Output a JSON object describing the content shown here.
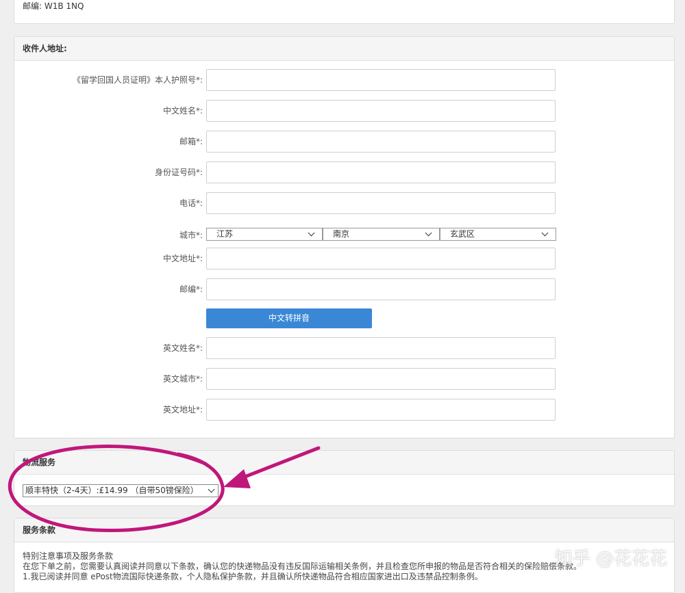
{
  "top_panel": {
    "postcode_line": "邮编:  W1B 1NQ"
  },
  "recipient": {
    "title": "收件人地址:",
    "fields": {
      "passport": "《留学回国人员证明》本人护照号*:",
      "cn_name": "中文姓名*:",
      "email": "邮箱*:",
      "id_number": "身份证号码*:",
      "phone": "电话*:",
      "city": "城市*:",
      "cn_address": "中文地址*:",
      "postcode": "邮编*:",
      "en_name": "英文姓名*:",
      "en_city": "英文城市*:",
      "en_address": "英文地址*:"
    },
    "city_selects": {
      "province": "江苏",
      "city": "南京",
      "district": "玄武区"
    },
    "convert_button": "中文转拼音"
  },
  "logistics": {
    "title": "物流服务",
    "selected_option": "顺丰特快（2-4天）:£14.99 （自带50镑保险）"
  },
  "terms": {
    "title": "服务条款",
    "lines": [
      "特别注意事项及服务条款",
      "在您下单之前，您需要认真阅读并同意以下条款，确认您的快递物品没有违反国际运输相关条例，并且检查您所申报的物品是否符合相关的保险赔偿条款。",
      "1.我已阅读并同意 ePost物流国际快递条款，个人隐私保护条款，并且确认所快递物品符合相应国家进出口及违禁品控制条例。"
    ]
  },
  "watermark": "知乎 @花花花",
  "colors": {
    "button_blue": "#3a87d6",
    "annotation_magenta": "#c0177a"
  }
}
